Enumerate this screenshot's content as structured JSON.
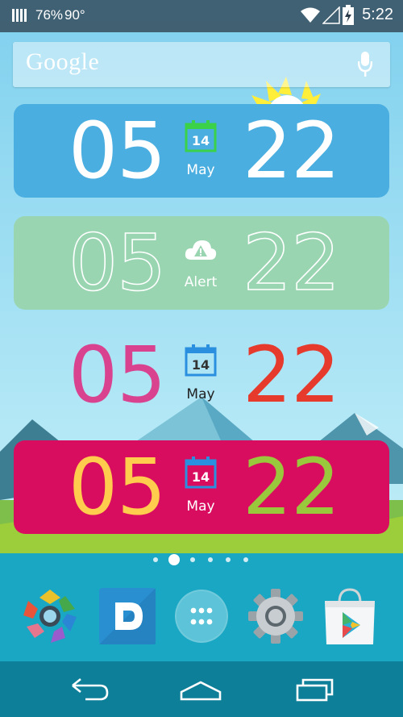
{
  "status_bar": {
    "battery_percent": "76%",
    "temperature": "90°",
    "time": "5:22",
    "icons": [
      "signal-bars-icon",
      "wifi-icon",
      "cell-signal-icon",
      "battery-charging-icon"
    ]
  },
  "search": {
    "logo_text": "Google",
    "mic_icon": "mic-icon"
  },
  "widgets": [
    {
      "style": "blue-card",
      "hours": "05",
      "minutes": "22",
      "icon": "calendar-icon",
      "icon_text": "14",
      "label": "May",
      "colors": {
        "card": "#4aaee0",
        "hours": "#ffffff",
        "minutes": "#ffffff",
        "label": "#ffffff",
        "icon": "#3bd24a"
      }
    },
    {
      "style": "green-card-outline",
      "hours": "05",
      "minutes": "22",
      "icon": "cloud-alert-icon",
      "icon_text": "",
      "label": "Alert",
      "colors": {
        "card": "#9ad5b2",
        "hours": "#ffffff",
        "minutes": "#ffffff",
        "label": "#ffffff",
        "icon": "#ffffff"
      }
    },
    {
      "style": "transparent",
      "hours": "05",
      "minutes": "22",
      "icon": "calendar-icon",
      "icon_text": "14",
      "label": "May",
      "colors": {
        "card": "transparent",
        "hours": "#d8428e",
        "minutes": "#e53a2c",
        "label": "#222222",
        "icon": "#2a8fde"
      }
    },
    {
      "style": "magenta-card",
      "hours": "05",
      "minutes": "22",
      "icon": "calendar-icon",
      "icon_text": "14",
      "label": "May",
      "colors": {
        "card": "#d90d5f",
        "hours": "#ffcc4d",
        "minutes": "#9ac83c",
        "label": "#ffffff",
        "icon": "#2a8fde"
      }
    }
  ],
  "page_indicator": {
    "count": 6,
    "active_index": 1
  },
  "dock": [
    {
      "name": "photo-app-icon"
    },
    {
      "name": "dashlane-app-icon",
      "letter": "D"
    },
    {
      "name": "app-drawer-icon"
    },
    {
      "name": "settings-app-icon"
    },
    {
      "name": "play-store-app-icon"
    }
  ],
  "nav_bar": [
    "back-icon",
    "home-icon",
    "recents-icon"
  ]
}
